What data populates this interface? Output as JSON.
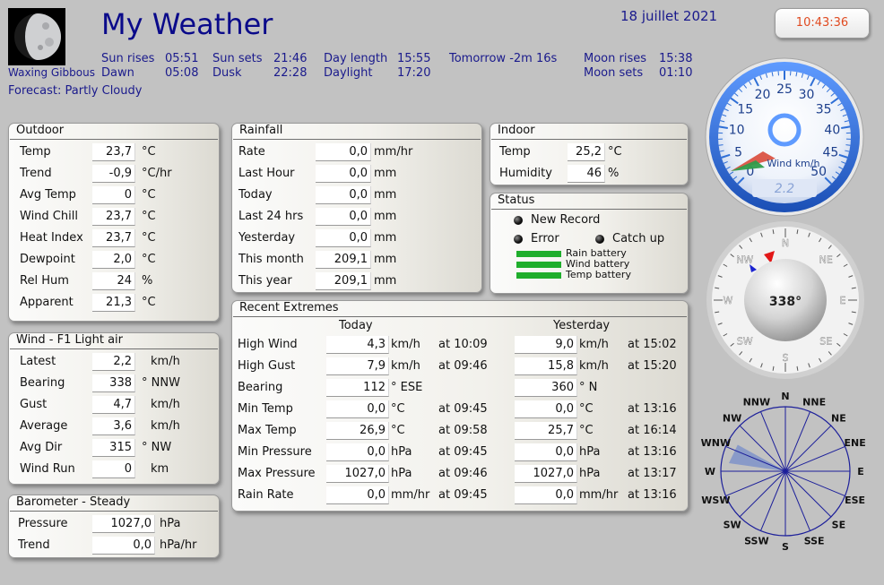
{
  "header": {
    "title": "My Weather",
    "date": "18 juillet 2021",
    "time": "10:43:36",
    "moon_phase": "Waxing Gibbous",
    "forecast": "Forecast: Partly Cloudy"
  },
  "astro": {
    "sun_rises_label": "Sun rises",
    "sun_rises": "05:51",
    "dawn_label": "Dawn",
    "dawn": "05:08",
    "sun_sets_label": "Sun sets",
    "sun_sets": "21:46",
    "dusk_label": "Dusk",
    "dusk": "22:28",
    "day_length_label": "Day length",
    "day_length": "15:55",
    "daylight_label": "Daylight",
    "daylight": "17:20",
    "tomorrow": "Tomorrow -2m 16s",
    "moon_rises_label": "Moon rises",
    "moon_rises": "15:38",
    "moon_sets_label": "Moon sets",
    "moon_sets": "01:10"
  },
  "outdoor": {
    "title": "Outdoor",
    "rows": [
      {
        "label": "Temp",
        "value": "23,7",
        "unit": "°C"
      },
      {
        "label": "Trend",
        "value": "-0,9",
        "unit": "°C/hr"
      },
      {
        "label": "Avg Temp",
        "value": "0",
        "unit": "°C"
      },
      {
        "label": "Wind Chill",
        "value": "23,7",
        "unit": "°C"
      },
      {
        "label": "Heat Index",
        "value": "23,7",
        "unit": "°C"
      },
      {
        "label": "Dewpoint",
        "value": "2,0",
        "unit": "°C"
      },
      {
        "label": "Rel Hum",
        "value": "24",
        "unit": "%"
      },
      {
        "label": "Apparent",
        "value": "21,3",
        "unit": "°C"
      }
    ]
  },
  "wind": {
    "title": "Wind - F1 Light air",
    "rows": [
      {
        "label": "Latest",
        "value": "2,2",
        "unit": "km/h"
      },
      {
        "label": "Bearing",
        "value": "338",
        "unit": "° NNW"
      },
      {
        "label": "Gust",
        "value": "4,7",
        "unit": "km/h"
      },
      {
        "label": "Average",
        "value": "3,6",
        "unit": "km/h"
      },
      {
        "label": "Avg Dir",
        "value": "315",
        "unit": "° NW"
      },
      {
        "label": "Wind Run",
        "value": "0",
        "unit": "km"
      }
    ]
  },
  "barometer": {
    "title": "Barometer - Steady",
    "rows": [
      {
        "label": "Pressure",
        "value": "1027,0",
        "unit": "hPa"
      },
      {
        "label": "Trend",
        "value": "0,0",
        "unit": "hPa/hr"
      }
    ]
  },
  "rainfall": {
    "title": "Rainfall",
    "rows": [
      {
        "label": "Rate",
        "value": "0,0",
        "unit": "mm/hr"
      },
      {
        "label": "Last Hour",
        "value": "0,0",
        "unit": "mm"
      },
      {
        "label": "Today",
        "value": "0,0",
        "unit": "mm"
      },
      {
        "label": "Last 24 hrs",
        "value": "0,0",
        "unit": "mm"
      },
      {
        "label": "Yesterday",
        "value": "0,0",
        "unit": "mm"
      },
      {
        "label": "This month",
        "value": "209,1",
        "unit": "mm"
      },
      {
        "label": "This year",
        "value": "209,1",
        "unit": "mm"
      }
    ]
  },
  "indoor": {
    "title": "Indoor",
    "rows": [
      {
        "label": "Temp",
        "value": "25,2",
        "unit": "°C"
      },
      {
        "label": "Humidity",
        "value": "46",
        "unit": "%"
      }
    ]
  },
  "status": {
    "title": "Status",
    "new_record": "New Record",
    "error": "Error",
    "catch_up": "Catch up",
    "batteries": [
      "Rain battery",
      "Wind battery",
      "Temp battery"
    ],
    "battery_color": "#1fae2c"
  },
  "extremes": {
    "title": "Recent Extremes",
    "today_header": "Today",
    "yesterday_header": "Yesterday",
    "rows": [
      {
        "label": "High Wind",
        "t_value": "4,3",
        "t_unit": "km/h",
        "t_time": "at 10:09",
        "y_value": "9,0",
        "y_unit": "km/h",
        "y_time": "at 15:02"
      },
      {
        "label": "High Gust",
        "t_value": "7,9",
        "t_unit": "km/h",
        "t_time": "at 09:46",
        "y_value": "15,8",
        "y_unit": "km/h",
        "y_time": "at 15:20"
      },
      {
        "label": "Bearing",
        "t_value": "112",
        "t_unit": "°  ESE",
        "t_time": "",
        "y_value": "360",
        "y_unit": "°  N",
        "y_time": ""
      },
      {
        "label": "Min Temp",
        "t_value": "0,0",
        "t_unit": "°C",
        "t_time": "at 09:45",
        "y_value": "0,0",
        "y_unit": "°C",
        "y_time": "at 13:16"
      },
      {
        "label": "Max Temp",
        "t_value": "26,9",
        "t_unit": "°C",
        "t_time": "at 09:58",
        "y_value": "25,7",
        "y_unit": "°C",
        "y_time": "at 16:14"
      },
      {
        "label": "Min Pressure",
        "t_value": "0,0",
        "t_unit": "hPa",
        "t_time": "at 09:45",
        "y_value": "0,0",
        "y_unit": "hPa",
        "y_time": "at 13:16"
      },
      {
        "label": "Max Pressure",
        "t_value": "1027,0",
        "t_unit": "hPa",
        "t_time": "at 09:46",
        "y_value": "1027,0",
        "y_unit": "hPa",
        "y_time": "at 13:17"
      },
      {
        "label": "Rain Rate",
        "t_value": "0,0",
        "t_unit": "mm/hr",
        "t_time": "at 09:45",
        "y_value": "0,0",
        "y_unit": "mm/hr",
        "y_time": "at 13:16"
      }
    ]
  },
  "gauges": {
    "speed": {
      "label": "Wind km/h",
      "readout": "2.2",
      "ticks": [
        "0",
        "5",
        "10",
        "15",
        "20",
        "25",
        "30",
        "35",
        "40",
        "45",
        "50"
      ],
      "value": 2.2,
      "max": 50
    },
    "compass": {
      "readout": "338°",
      "bearing": 338,
      "cardinals": [
        "N",
        "NE",
        "E",
        "SE",
        "S",
        "SW",
        "W",
        "NW"
      ]
    },
    "rose": {
      "directions": [
        "N",
        "NNE",
        "NE",
        "ENE",
        "E",
        "ESE",
        "SE",
        "SSE",
        "S",
        "SSW",
        "SW",
        "WSW",
        "W",
        "WNW",
        "NW",
        "NNW"
      ]
    }
  },
  "colors": {
    "title": "#0a0a8a",
    "astro_text": "#1a1a8c",
    "clock_text": "#e04a20",
    "gauge_blue": "#2f6fd6",
    "rose_fill": "#7f93c9"
  }
}
